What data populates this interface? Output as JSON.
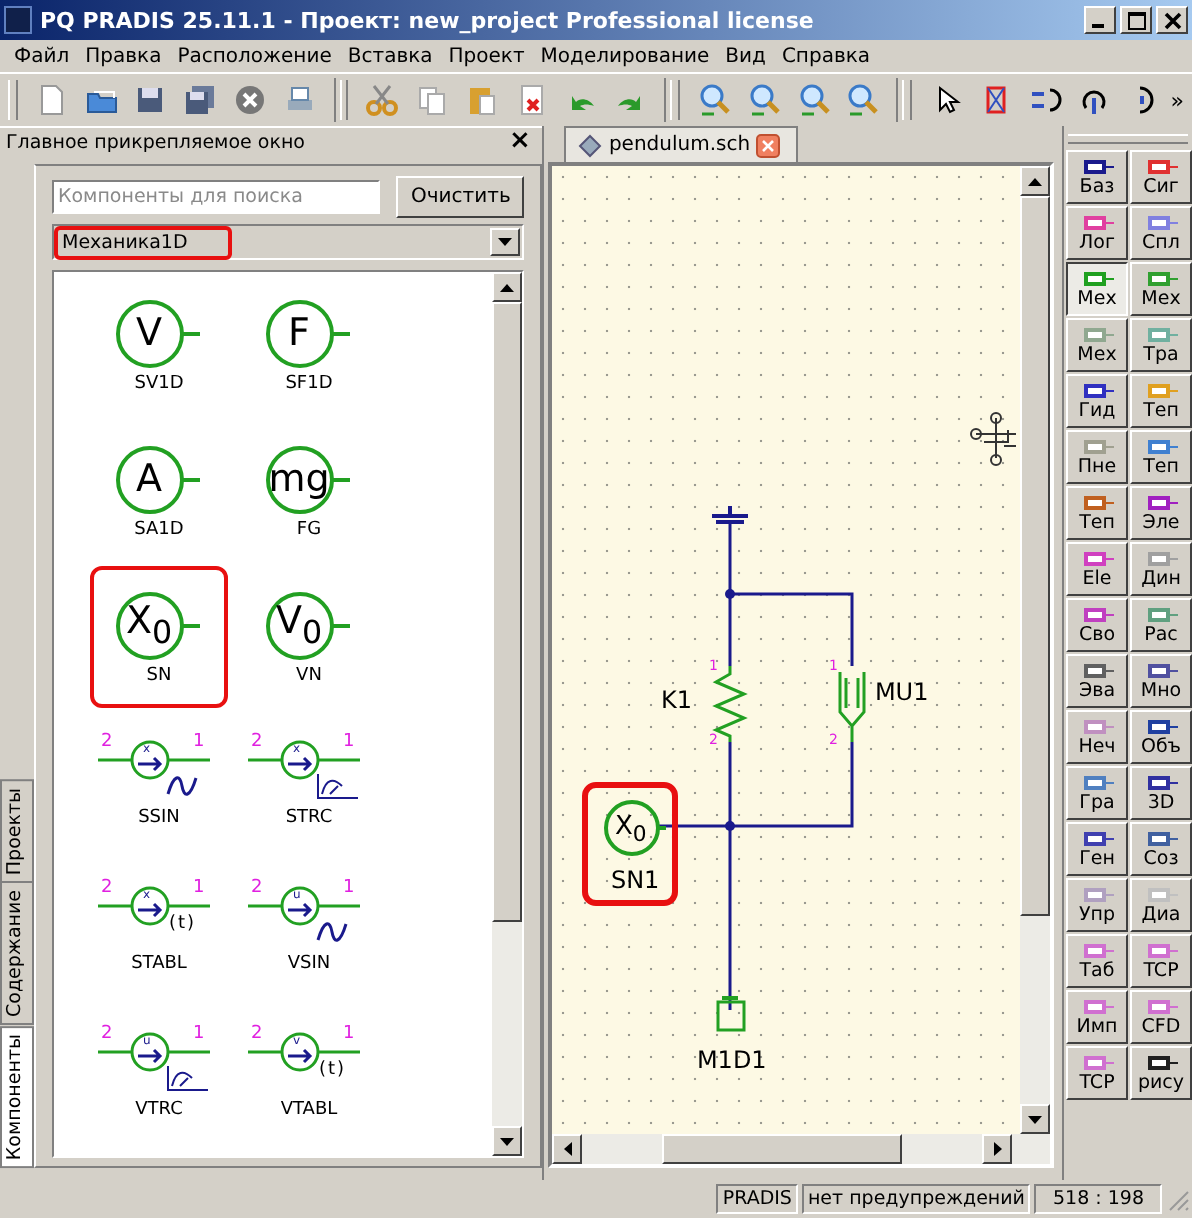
{
  "window": {
    "title": "PQ PRADIS 25.11.1 - Проект: new_project Professional license"
  },
  "menu": [
    "Файл",
    "Правка",
    "Расположение",
    "Вставка",
    "Проект",
    "Моделирование",
    "Вид",
    "Справка"
  ],
  "toolbar": {
    "overflow": "»"
  },
  "dock": {
    "title": "Главное прикрепляемое окно",
    "close": "×",
    "side_tabs": [
      {
        "label": "Проекты",
        "selected": false
      },
      {
        "label": "Содержание",
        "selected": false
      },
      {
        "label": "Компоненты",
        "selected": true
      }
    ],
    "search": {
      "placeholder": "Компоненты для поиска"
    },
    "clear_button": "Очистить",
    "category": {
      "value": "Механика1D",
      "highlighted": true
    },
    "components": [
      {
        "kind": "meter",
        "symbol": "V",
        "label": "SV1D",
        "highlighted": false
      },
      {
        "kind": "meter",
        "symbol": "F",
        "label": "SF1D",
        "highlighted": false
      },
      {
        "kind": "meter",
        "symbol": "A",
        "label": "SA1D",
        "highlighted": false
      },
      {
        "kind": "meter",
        "symbol": "mg",
        "label": "FG",
        "highlighted": false
      },
      {
        "kind": "meter",
        "symbol": "X$_{0}$",
        "label": "SN",
        "highlighted": true
      },
      {
        "kind": "meter",
        "symbol": "V$_{0}$",
        "label": "VN",
        "highlighted": false
      },
      {
        "kind": "sine",
        "inner": "x",
        "pins": [
          "2",
          "1"
        ],
        "label": "SSIN",
        "highlighted": false
      },
      {
        "kind": "trace",
        "inner": "x",
        "pins": [
          "2",
          "1"
        ],
        "label": "STRC",
        "highlighted": false
      },
      {
        "kind": "table",
        "inner": "x",
        "pins": [
          "2",
          "1"
        ],
        "suffix": "(t)",
        "label": "STABL",
        "highlighted": false
      },
      {
        "kind": "sine",
        "inner": "u",
        "pins": [
          "2",
          "1"
        ],
        "label": "VSIN",
        "highlighted": false
      },
      {
        "kind": "trace",
        "inner": "u",
        "pins": [
          "2",
          "1"
        ],
        "label": "VTRC",
        "highlighted": false
      },
      {
        "kind": "table",
        "inner": "v",
        "pins": [
          "2",
          "1"
        ],
        "suffix": "(t)",
        "label": "VTABL",
        "highlighted": false
      }
    ]
  },
  "document_tabs": [
    {
      "label": "pendulum.sch",
      "selected": true
    }
  ],
  "schematic": {
    "spring": {
      "label": "K1",
      "pins": [
        "1",
        "2"
      ]
    },
    "damper": {
      "label": "MU1",
      "pins": [
        "1",
        "2"
      ]
    },
    "source": {
      "symbol": "X$_{0}$",
      "label": "SN1",
      "highlighted": true
    },
    "mass": {
      "label": "M1D1"
    }
  },
  "palette": [
    {
      "label": "Баз",
      "color": "#1a1a8c",
      "selected": false
    },
    {
      "label": "Сиг",
      "color": "#e03030",
      "selected": false
    },
    {
      "label": "Лог",
      "color": "#e040a0",
      "selected": false
    },
    {
      "label": "Спл",
      "color": "#8080e0",
      "selected": false
    },
    {
      "label": "Мех",
      "color": "#20a020",
      "selected": true
    },
    {
      "label": "Мех",
      "color": "#30a030",
      "selected": false
    },
    {
      "label": "Мех",
      "color": "#90a890",
      "selected": false
    },
    {
      "label": "Тра",
      "color": "#70b0a0",
      "selected": false
    },
    {
      "label": "Гид",
      "color": "#3030c0",
      "selected": false
    },
    {
      "label": "Теп",
      "color": "#e0a020",
      "selected": false
    },
    {
      "label": "Пне",
      "color": "#a0a090",
      "selected": false
    },
    {
      "label": "Теп",
      "color": "#4080d0",
      "selected": false
    },
    {
      "label": "Теп",
      "color": "#c06020",
      "selected": false
    },
    {
      "label": "Эле",
      "color": "#a020c0",
      "selected": false
    },
    {
      "label": "Ele",
      "color": "#d040c0",
      "selected": false
    },
    {
      "label": "Дин",
      "color": "#a0a0a0",
      "selected": false
    },
    {
      "label": "Сво",
      "color": "#c040c0",
      "selected": false
    },
    {
      "label": "Рас",
      "color": "#60a080",
      "selected": false
    },
    {
      "label": "Эва",
      "color": "#606060",
      "selected": false
    },
    {
      "label": "Мно",
      "color": "#5050a0",
      "selected": false
    },
    {
      "label": "Неч",
      "color": "#c090c0",
      "selected": false
    },
    {
      "label": "Объ",
      "color": "#2040a0",
      "selected": false
    },
    {
      "label": "Гра",
      "color": "#5080c0",
      "selected": false
    },
    {
      "label": "3D",
      "color": "#3030a0",
      "selected": false
    },
    {
      "label": "Ген",
      "color": "#4040b0",
      "selected": false
    },
    {
      "label": "Соз",
      "color": "#4060a0",
      "selected": false
    },
    {
      "label": "Упр",
      "color": "#b0a0c0",
      "selected": false
    },
    {
      "label": "Диа",
      "color": "#c0c0c0",
      "selected": false
    },
    {
      "label": "Таб",
      "color": "#d070d0",
      "selected": false
    },
    {
      "label": "TCP",
      "color": "#d070d0",
      "selected": false
    },
    {
      "label": "Имп",
      "color": "#d070d0",
      "selected": false
    },
    {
      "label": "CFD",
      "color": "#d070d0",
      "selected": false
    },
    {
      "label": "TCP",
      "color": "#d070d0",
      "selected": false
    },
    {
      "label": "рису",
      "color": "#202020",
      "selected": false
    }
  ],
  "status_bar": {
    "app": "PRADIS",
    "messages": "нет предупреждений",
    "coords": "518 : 198"
  }
}
